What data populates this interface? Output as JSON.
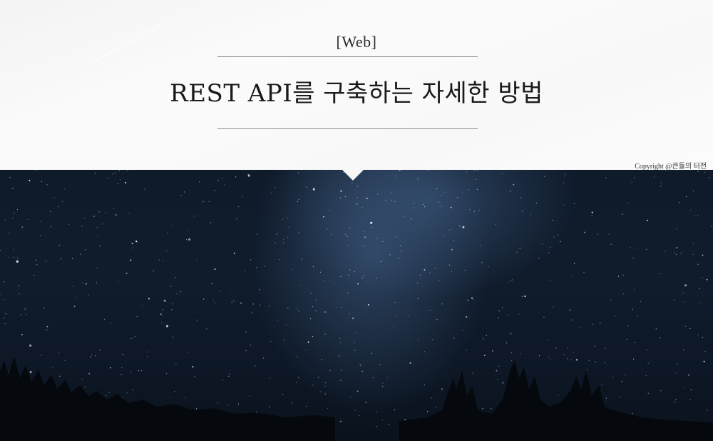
{
  "header": {
    "category": "[Web]",
    "title": "REST API를 구축하는 자세한 방법",
    "copyright": "Copyright @큰들의 터전"
  },
  "colors": {
    "header_bg": "#fafafa",
    "rule": "#8e8e8e",
    "title_text": "#1a1a1a",
    "sky_dark": "#0f1b2b",
    "sky_glow": "#5073a0"
  }
}
